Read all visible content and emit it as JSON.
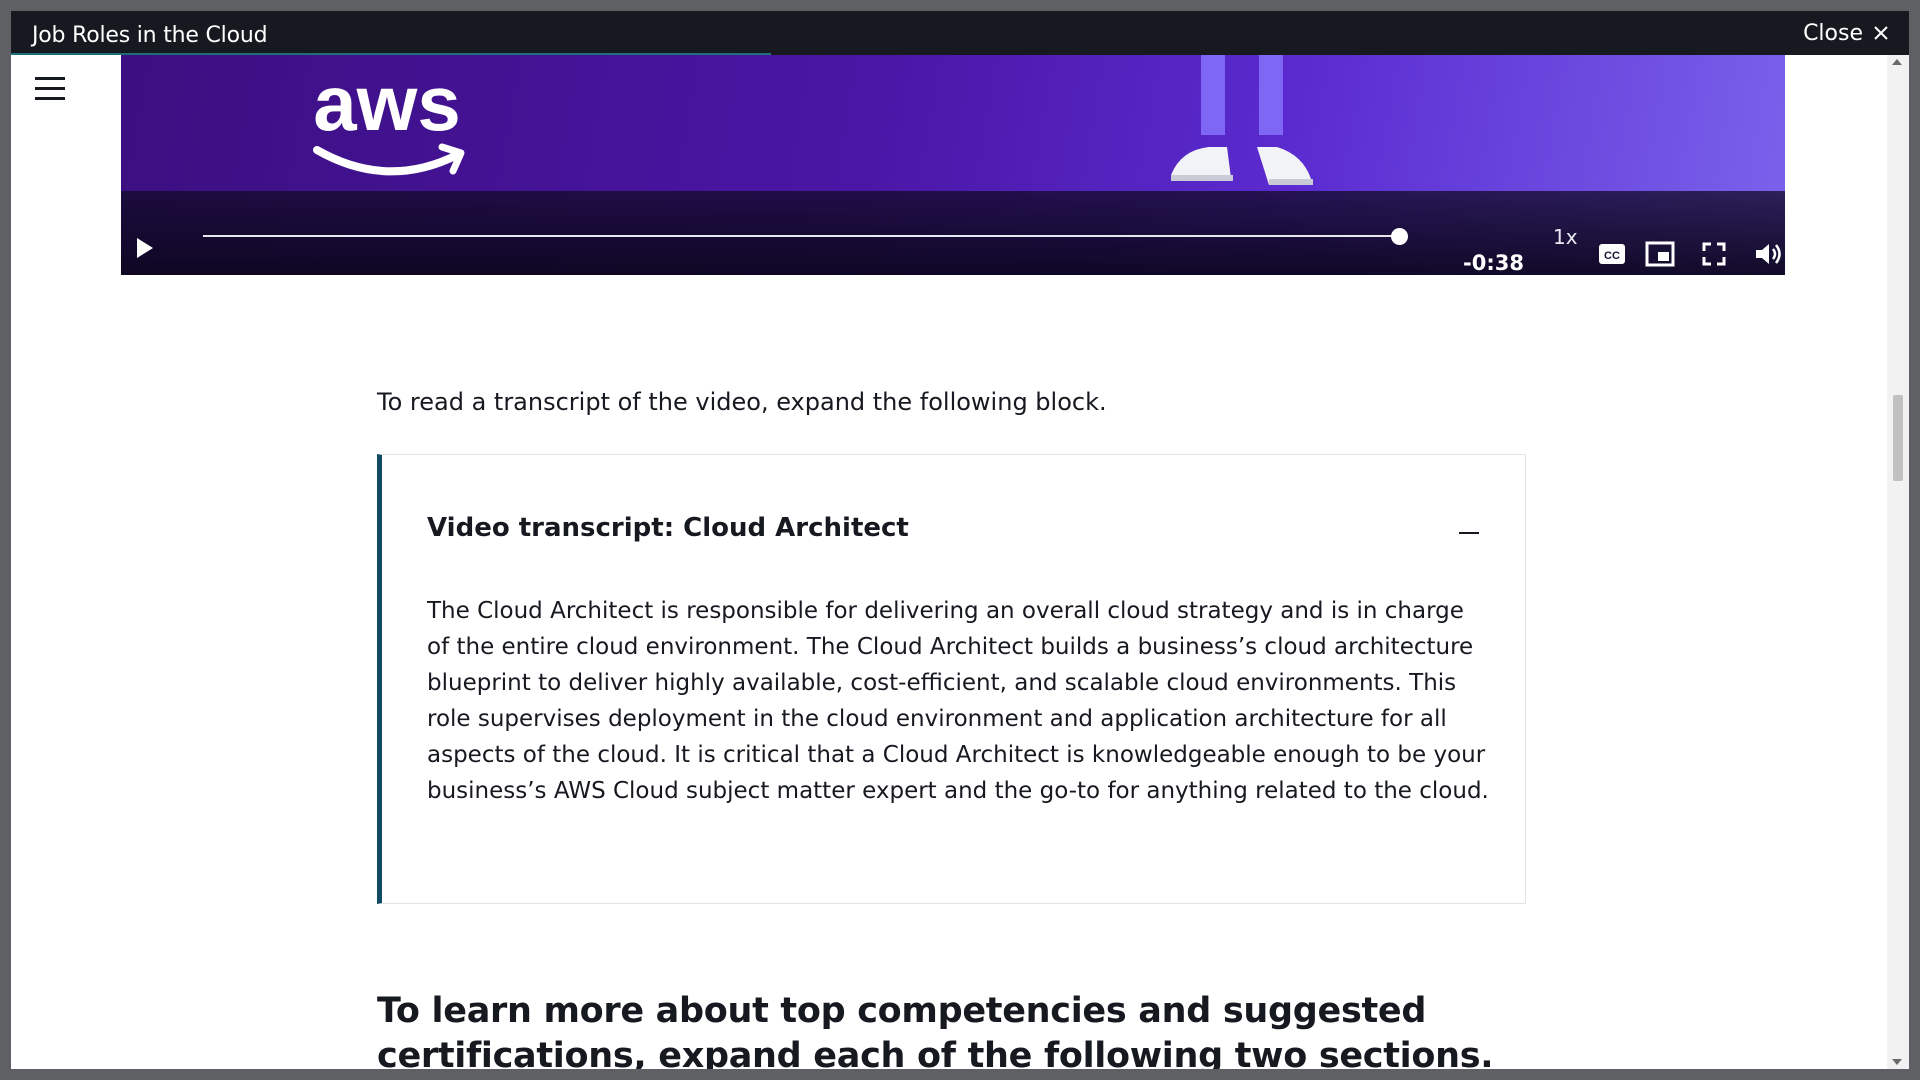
{
  "window": {
    "title": "Job Roles in the Cloud",
    "close_label": "Close"
  },
  "video": {
    "logo_text": "aws",
    "time_remaining": "-0:38",
    "playback_speed": "1x",
    "progress": 1.0
  },
  "content": {
    "intro": "To read a transcript of the video, expand the following block.",
    "transcript": {
      "title": "Video transcript: Cloud Architect",
      "body": "The Cloud Architect is responsible for delivering an overall cloud strategy and is in charge of the entire cloud environment. The Cloud Architect builds a business’s cloud architecture blueprint to deliver highly available, cost-efficient, and scalable cloud environments. This role supervises deployment in the cloud environment and application architecture for all aspects of the cloud. It is critical that a Cloud Architect is knowledgeable enough to be your business’s AWS Cloud subject matter expert and the go-to for anything related to the cloud."
    },
    "section_heading": "To learn more about top competencies and suggested certifications, expand each of the following two sections."
  },
  "colors": {
    "titlebar": "#16191f",
    "accent_border": "#0f4c64",
    "video_bg": "#4a16a6"
  },
  "icons": [
    "menu-icon",
    "close-icon",
    "play-icon",
    "captions-icon",
    "picture-in-picture-icon",
    "fullscreen-icon",
    "volume-icon",
    "collapse-icon"
  ]
}
